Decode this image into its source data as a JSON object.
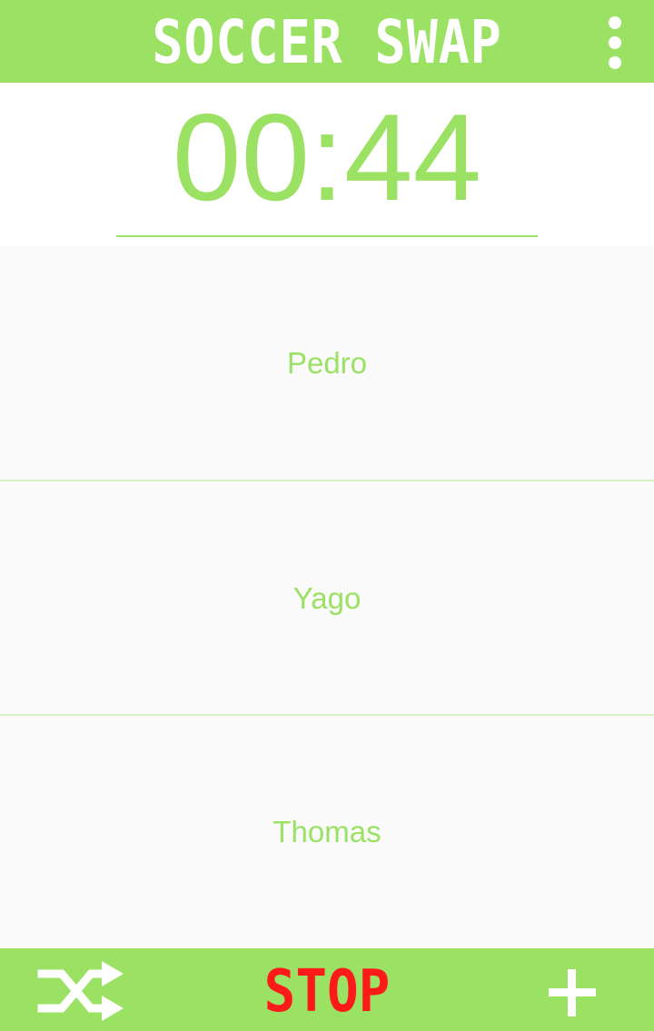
{
  "header": {
    "title": "SOCCER SWAP",
    "menu_icon": "more-vert-icon"
  },
  "timer": {
    "value": "00:44"
  },
  "players": [
    {
      "name": "Pedro"
    },
    {
      "name": "Yago"
    },
    {
      "name": "Thomas"
    }
  ],
  "footer": {
    "shuffle_icon": "shuffle-icon",
    "stop_label": "STOP",
    "add_icon": "plus-icon"
  },
  "colors": {
    "accent": "#9be164",
    "stop": "#ff1a1a",
    "list_background": "#fafafa"
  }
}
